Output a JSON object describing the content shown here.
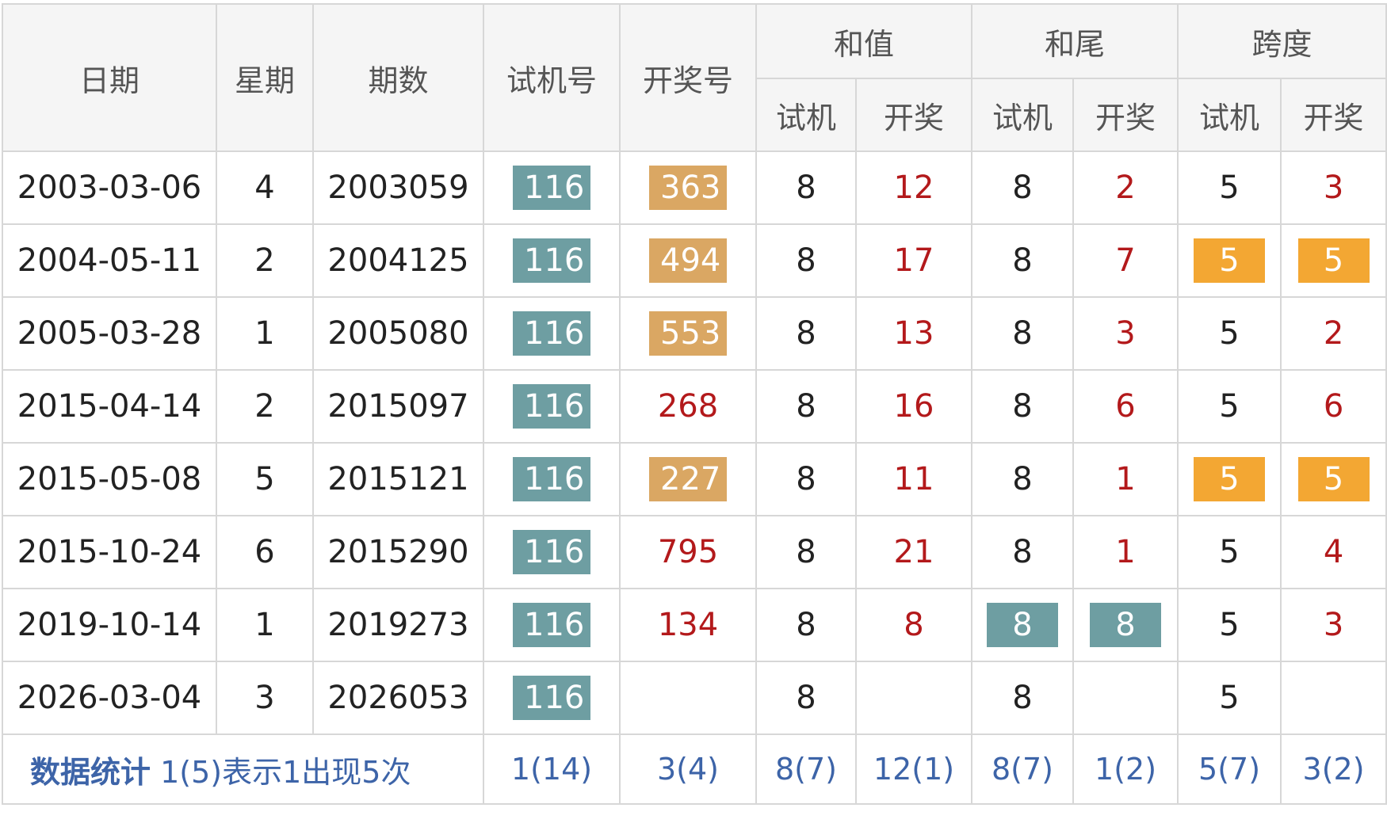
{
  "headers": {
    "date": "日期",
    "weekday": "星期",
    "period": "期数",
    "trial": "试机号",
    "draw": "开奖号",
    "sum": "和值",
    "tail": "和尾",
    "span": "跨度",
    "sub_trial": "试机",
    "sub_draw": "开奖"
  },
  "rows": [
    {
      "date": "2003-03-06",
      "weekday": "4",
      "period": "2003059",
      "trial": "116",
      "draw": "363",
      "sum_trial": "8",
      "sum_draw": "12",
      "tail_trial": "8",
      "tail_draw": "2",
      "span_trial": "5",
      "span_draw": "3"
    },
    {
      "date": "2004-05-11",
      "weekday": "2",
      "period": "2004125",
      "trial": "116",
      "draw": "494",
      "sum_trial": "8",
      "sum_draw": "17",
      "tail_trial": "8",
      "tail_draw": "7",
      "span_trial": "5",
      "span_draw": "5"
    },
    {
      "date": "2005-03-28",
      "weekday": "1",
      "period": "2005080",
      "trial": "116",
      "draw": "553",
      "sum_trial": "8",
      "sum_draw": "13",
      "tail_trial": "8",
      "tail_draw": "3",
      "span_trial": "5",
      "span_draw": "2"
    },
    {
      "date": "2015-04-14",
      "weekday": "2",
      "period": "2015097",
      "trial": "116",
      "draw": "268",
      "sum_trial": "8",
      "sum_draw": "16",
      "tail_trial": "8",
      "tail_draw": "6",
      "span_trial": "5",
      "span_draw": "6"
    },
    {
      "date": "2015-05-08",
      "weekday": "5",
      "period": "2015121",
      "trial": "116",
      "draw": "227",
      "sum_trial": "8",
      "sum_draw": "11",
      "tail_trial": "8",
      "tail_draw": "1",
      "span_trial": "5",
      "span_draw": "5"
    },
    {
      "date": "2015-10-24",
      "weekday": "6",
      "period": "2015290",
      "trial": "116",
      "draw": "795",
      "sum_trial": "8",
      "sum_draw": "21",
      "tail_trial": "8",
      "tail_draw": "1",
      "span_trial": "5",
      "span_draw": "4"
    },
    {
      "date": "2019-10-14",
      "weekday": "1",
      "period": "2019273",
      "trial": "116",
      "draw": "134",
      "sum_trial": "8",
      "sum_draw": "8",
      "tail_trial": "8",
      "tail_draw": "8",
      "span_trial": "5",
      "span_draw": "3"
    },
    {
      "date": "2026-03-04",
      "weekday": "3",
      "period": "2026053",
      "trial": "116",
      "draw": "",
      "sum_trial": "8",
      "sum_draw": "",
      "tail_trial": "8",
      "tail_draw": "",
      "span_trial": "5",
      "span_draw": ""
    }
  ],
  "stats": {
    "label": "数据统计",
    "note": "1(5)表示1出现5次",
    "trial": "1(14)",
    "draw": "3(4)",
    "sum_trial": "8(7)",
    "sum_draw": "12(1)",
    "tail_trial": "8(7)",
    "tail_draw": "1(2)",
    "span_trial": "5(7)",
    "span_draw": "3(2)"
  },
  "colors": {
    "trial_badge": "#6e9ea2",
    "draw_badge": "#daa763",
    "span_badge": "#f3a733",
    "red_text": "#b3191b",
    "stat_text": "#3d64a8"
  }
}
